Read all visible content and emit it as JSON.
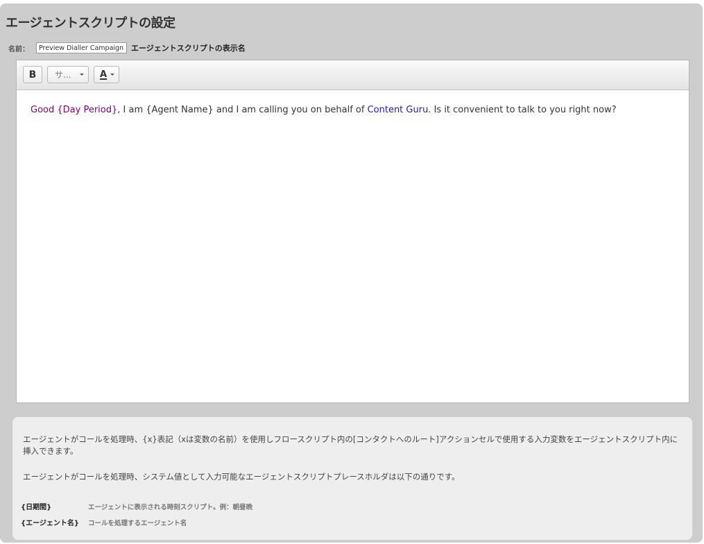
{
  "page": {
    "title": "エージェントスクリプトの設定"
  },
  "name_field": {
    "label": "名前：",
    "value": "Preview Dialler Campaign",
    "description": "エージェントスクリプトの表示名"
  },
  "toolbar": {
    "bold_label": "B",
    "font_size_label": "サ...",
    "font_color_label": "A",
    "icons": [
      "chevron-down-icon",
      "font-color-icon"
    ]
  },
  "editor": {
    "segments": [
      {
        "text": "Good ",
        "color": "#800080"
      },
      {
        "text": "{Day Period}",
        "color": "#800080"
      },
      {
        "text": ", I am {Agent Name} and I am calling you on behalf of ",
        "color": "#333333"
      },
      {
        "text": "Content Guru",
        "color": "#1a1acc"
      },
      {
        "text": ". Is it convenient to talk to you right now?",
        "color": "#333333"
      }
    ]
  },
  "info": {
    "paragraph1": "エージェントがコールを処理時、{x}表記（xは変数の名前）を使用しフロースクリプト内の[コンタクトへのルート]アクションセルで使用する入力変数をエージェントスクリプト内に挿入できます。",
    "paragraph2": "エージェントがコールを処理時、システム値として入力可能なエージェントスクリプトプレースホルダは以下の通りです。",
    "placeholders": [
      {
        "key": "{日期間}",
        "description": "エージェントに表示される時刻スクリプト。例：朝昼晩"
      },
      {
        "key": "{エージェント名}",
        "description": "コールを処理するエージェント名"
      }
    ]
  },
  "colors": {
    "panel_bg": "#cdcdcd",
    "info_bg": "#eeeeee",
    "placeholder_purple": "#800080",
    "brand_blue": "#1a1acc"
  }
}
